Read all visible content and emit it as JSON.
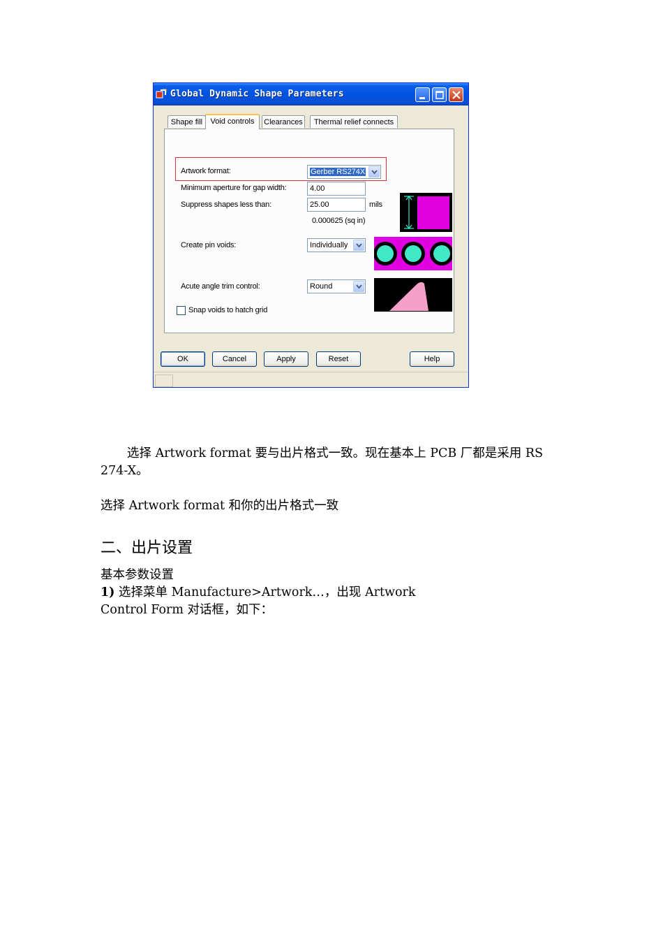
{
  "dialog": {
    "title": "Global Dynamic Shape Parameters",
    "tabs": [
      "Shape fill",
      "Void controls",
      "Clearances",
      "Thermal relief connects"
    ],
    "active_tab": "Void controls",
    "artwork_format": {
      "label": "Artwork format:",
      "value": "Gerber RS274X"
    },
    "min_aperture": {
      "label": "Minimum aperture for gap width:",
      "value": "4.00"
    },
    "suppress_shapes": {
      "label": "Suppress shapes less than:",
      "value": "25.00",
      "unit": "mils",
      "area": "0.000625 (sq in)"
    },
    "create_pin_voids": {
      "label": "Create pin voids:",
      "value": "Individually"
    },
    "acute_angle": {
      "label": "Acute angle trim control:",
      "value": "Round"
    },
    "snap_voids": {
      "label": "Snap voids to hatch grid",
      "checked": false
    },
    "buttons": {
      "ok": "OK",
      "cancel": "Cancel",
      "apply": "Apply",
      "reset": "Reset",
      "help": "Help"
    },
    "colors": {
      "magenta": "#e000e0",
      "teal": "#40e8c8",
      "pink": "#f4a0c8"
    }
  },
  "text": {
    "para1_line1": "选择 Artwork format  要与出片格式一致。现在基本上 PCB 厂都是采用 RS",
    "para1_line2": "274-X。",
    "para2": "选择 Artwork format  和你的出片格式一致",
    "heading": "二、出片设置",
    "subheading": "基本参数设置",
    "step1_num": "1)",
    "step1_line1": " 选择菜单 Manufacture>Artwork…，出现 Artwork",
    "step1_line2": "Control Form  对话框，如下："
  }
}
